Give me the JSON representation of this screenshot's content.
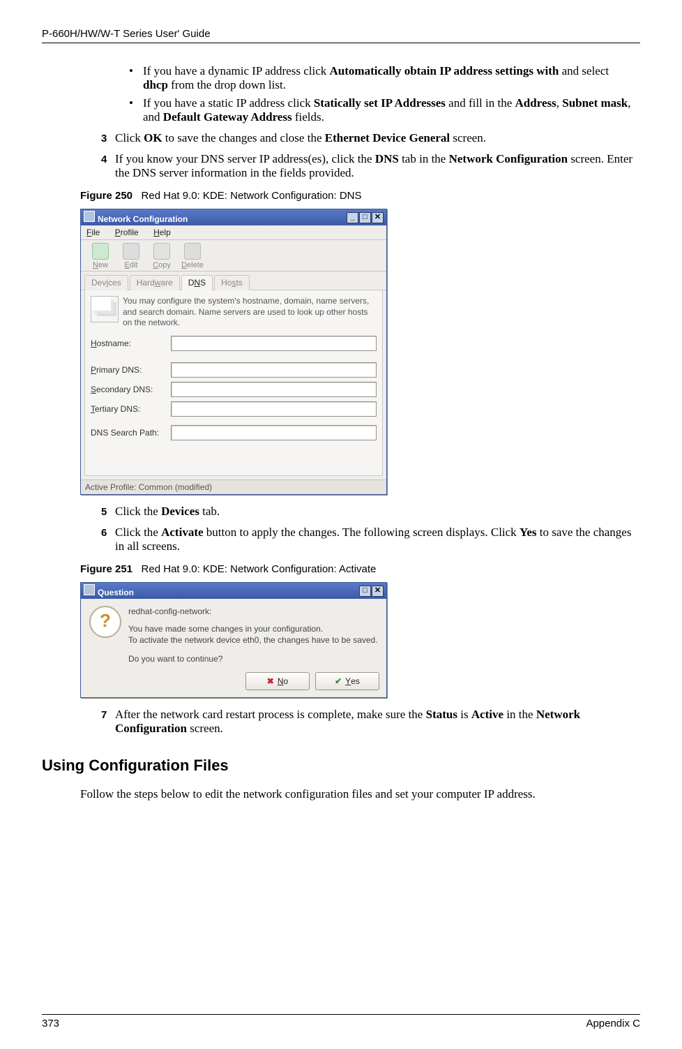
{
  "header": {
    "left": "P-660H/HW/W-T Series User' Guide",
    "right": ""
  },
  "footer": {
    "left": "373",
    "right": "Appendix C"
  },
  "bullets": [
    {
      "pre": "If you have a dynamic IP address click ",
      "b1": "Automatically obtain IP address settings with",
      "mid": " and select ",
      "b2": "dhcp",
      "post": " from the drop down list."
    },
    {
      "pre": "If you have a static IP address click ",
      "b1": "Statically set IP Addresses",
      "mid": " and fill in the ",
      "b2": "Address",
      "c": ", ",
      "b3": "Subnet mask",
      "c2": ", and ",
      "b4": "Default Gateway Address",
      "post": " fields."
    }
  ],
  "steps": {
    "s3": {
      "n": "3",
      "pre": "Click ",
      "b1": "OK",
      "mid": " to save the changes and close the ",
      "b2": "Ethernet Device General",
      "post": " screen."
    },
    "s4": {
      "n": "4",
      "pre": "If you know your DNS server IP address(es), click the ",
      "b1": "DNS",
      "mid": " tab in the ",
      "b2": "Network Configuration",
      "post": " screen. Enter the DNS server information in the fields provided."
    },
    "s5": {
      "n": "5",
      "pre": "Click the ",
      "b1": "Devices",
      "post": " tab."
    },
    "s6": {
      "n": "6",
      "pre": "Click the ",
      "b1": "Activate",
      "mid": " button to apply the changes. The following screen displays. Click ",
      "b2": "Yes",
      "post": " to save the changes in all screens."
    },
    "s7": {
      "n": "7",
      "pre": "After the network card restart process is complete, make sure the ",
      "b1": "Status",
      "mid": " is ",
      "b2": "Active",
      "mid2": " in the ",
      "b3": "Network Configuration",
      "post": " screen."
    }
  },
  "fig250": {
    "label": "Figure 250",
    "caption": "Red Hat 9.0: KDE: Network Configuration: DNS"
  },
  "fig251": {
    "label": "Figure 251",
    "caption": "Red Hat 9.0: KDE: Network Configuration: Activate "
  },
  "h2": "Using Configuration Files",
  "para_after_h2": "Follow the steps below to edit the network configuration files and set your computer IP address.",
  "win1": {
    "title": "Network Configuration",
    "wbtn_min": "_",
    "wbtn_max": "□",
    "wbtn_close": "✕",
    "menu": {
      "file": "File",
      "profile": "Profile",
      "help": "Help",
      "file_u": "F",
      "profile_u": "P",
      "help_u": "H"
    },
    "toolbar": {
      "new": "New",
      "edit": "Edit",
      "copy": "Copy",
      "delete": "Delete",
      "new_u": "N",
      "edit_u": "E",
      "copy_u": "C",
      "del_u": "D"
    },
    "tabs": {
      "devices": "Devices",
      "hardware": "Hardware",
      "dns": "DNS",
      "hosts": "Hosts",
      "dev_u": "i",
      "hw_u": "w",
      "dns_u": "N",
      "hosts_u": "s"
    },
    "hint": "You may configure the system's hostname, domain, name servers, and search domain. Name servers are used to look up other hosts on the network.",
    "labels": {
      "hostname": "Hostname:",
      "hostname_u": "H",
      "pdns": "Primary DNS:",
      "pdns_u": "P",
      "sdns": "Secondary DNS:",
      "sdns_u": "S",
      "tdns": "Tertiary DNS:",
      "tdns_u": "T",
      "search": "DNS Search Path:"
    },
    "status": "Active Profile: Common (modified)"
  },
  "win2": {
    "title": "Question",
    "wbtn_max": "□",
    "wbtn_close": "✕",
    "line1": "redhat-config-network:",
    "line2": "You have made some changes in your configuration.",
    "line3": "To activate the network device eth0, the changes have to be saved.",
    "line4": "Do you want to continue?",
    "no": "No",
    "no_u": "N",
    "yes": "Yes",
    "yes_u": "Y"
  }
}
